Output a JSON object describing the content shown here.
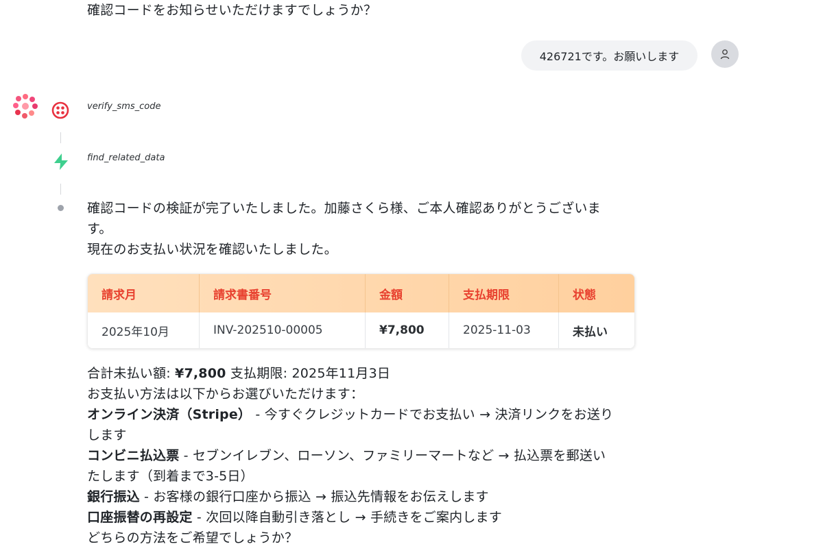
{
  "conversation": {
    "previous_assistant_text": "確認コードをお知らせいただけますでしょうか？",
    "user_message": "426721です。お願いします",
    "tools": [
      {
        "name": "verify_sms_code",
        "icon": "twilio-icon",
        "color": "#e8313f"
      },
      {
        "name": "find_related_data",
        "icon": "supabase-icon",
        "color": "#3ecf8e"
      }
    ],
    "reply": {
      "line1": "確認コードの検証が完了いたしました。加藤さくら様、ご本人確認ありがとうございま",
      "line2": "す。",
      "line3": "現在のお支払い状況を確認いたしました。"
    },
    "table": {
      "headers": [
        "請求月",
        "請求書番号",
        "金額",
        "支払期限",
        "状態"
      ],
      "rows": [
        [
          "2025年10月",
          "INV-202510-00005",
          "¥7,800",
          "2025-11-03",
          "未払い"
        ]
      ]
    },
    "summary": {
      "total_label": "合計未払い額: ",
      "total_value": "¥7,800",
      "due_text": " 支払期限: 2025年11月3日",
      "methods_intro": "お支払い方法は以下からお選びいただけます：",
      "method1_title": "オンライン決済（Stripe）",
      "method1_desc_a": " - 今すぐクレジットカードでお支払い → 決済リンクをお送り",
      "method1_desc_b": "します",
      "method2_title": "コンビニ払込票",
      "method2_desc_a": " - セブンイレブン、ローソン、ファミリーマートなど → 払込票を郵送い",
      "method2_desc_b": "たします（到着まで3-5日）",
      "method3_title": "銀行振込",
      "method3_desc": " - お客様の銀行口座から振込 → 振込先情報をお伝えします",
      "method4_title": "口座振替の再設定",
      "method4_desc": " - 次回以降自動引き落とし → 手続きをご案内します",
      "closing": "どちらの方法をご希望でしょうか？"
    }
  },
  "colors": {
    "header_text": "#e8412f",
    "header_bg_start": "#ffe0bd",
    "header_bg_end": "#ffd09e",
    "bubble_bg": "#f2f3f5"
  }
}
